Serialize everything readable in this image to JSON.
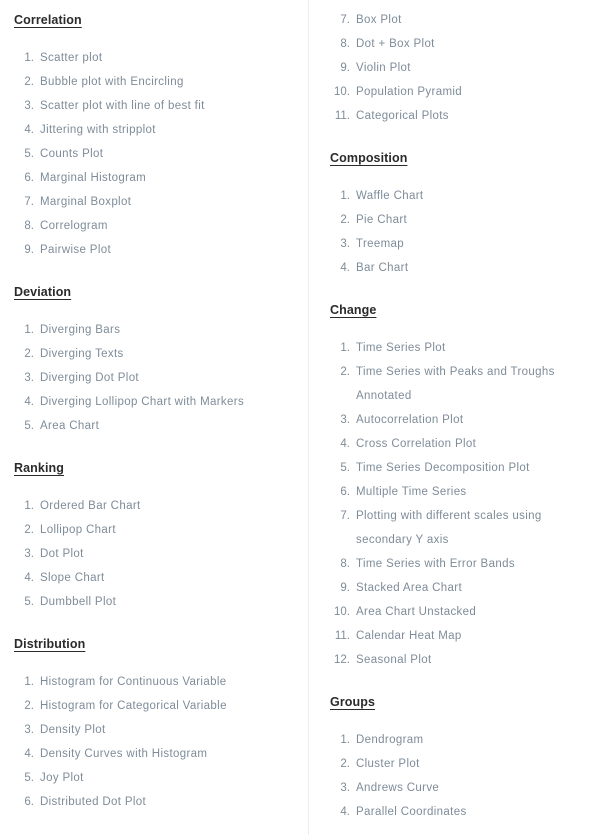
{
  "page": {
    "background_color": "#ffffff",
    "divider_color": "#ededf0",
    "heading_color": "#2b2b2b",
    "item_text_color": "#7e8c99"
  },
  "left_column": {
    "sections": [
      {
        "heading": "Correlation",
        "items": [
          "Scatter plot",
          "Bubble plot with Encircling",
          "Scatter plot with line of best fit",
          "Jittering with stripplot",
          "Counts Plot",
          "Marginal Histogram",
          "Marginal Boxplot",
          "Correlogram",
          "Pairwise Plot"
        ]
      },
      {
        "heading": "Deviation",
        "items": [
          "Diverging Bars",
          "Diverging Texts",
          "Diverging Dot Plot",
          "Diverging Lollipop Chart with Markers",
          "Area Chart"
        ]
      },
      {
        "heading": "Ranking",
        "items": [
          "Ordered Bar Chart",
          "Lollipop Chart",
          "Dot Plot",
          "Slope Chart",
          "Dumbbell Plot"
        ]
      },
      {
        "heading": "Distribution",
        "items": [
          "Histogram for Continuous Variable",
          "Histogram for Categorical Variable",
          "Density Plot",
          "Density Curves with Histogram",
          "Joy Plot",
          "Distributed Dot Plot"
        ]
      }
    ]
  },
  "right_column": {
    "sections": [
      {
        "heading": null,
        "start_number": 7,
        "items": [
          "Box Plot",
          "Dot + Box Plot",
          "Violin Plot",
          "Population Pyramid",
          "Categorical Plots"
        ]
      },
      {
        "heading": "Composition",
        "items": [
          "Waffle Chart",
          "Pie Chart",
          "Treemap",
          "Bar Chart"
        ]
      },
      {
        "heading": "Change",
        "items": [
          "Time Series Plot",
          "Time Series with Peaks and Troughs Annotated",
          "Autocorrelation Plot",
          "Cross Correlation Plot",
          "Time Series Decomposition Plot",
          "Multiple Time Series",
          "Plotting with different scales using secondary Y axis",
          "Time Series with Error Bands",
          "Stacked Area Chart",
          "Area Chart Unstacked",
          "Calendar Heat Map",
          "Seasonal Plot"
        ]
      },
      {
        "heading": "Groups",
        "items": [
          "Dendrogram",
          "Cluster Plot",
          "Andrews Curve",
          "Parallel Coordinates"
        ]
      }
    ]
  }
}
